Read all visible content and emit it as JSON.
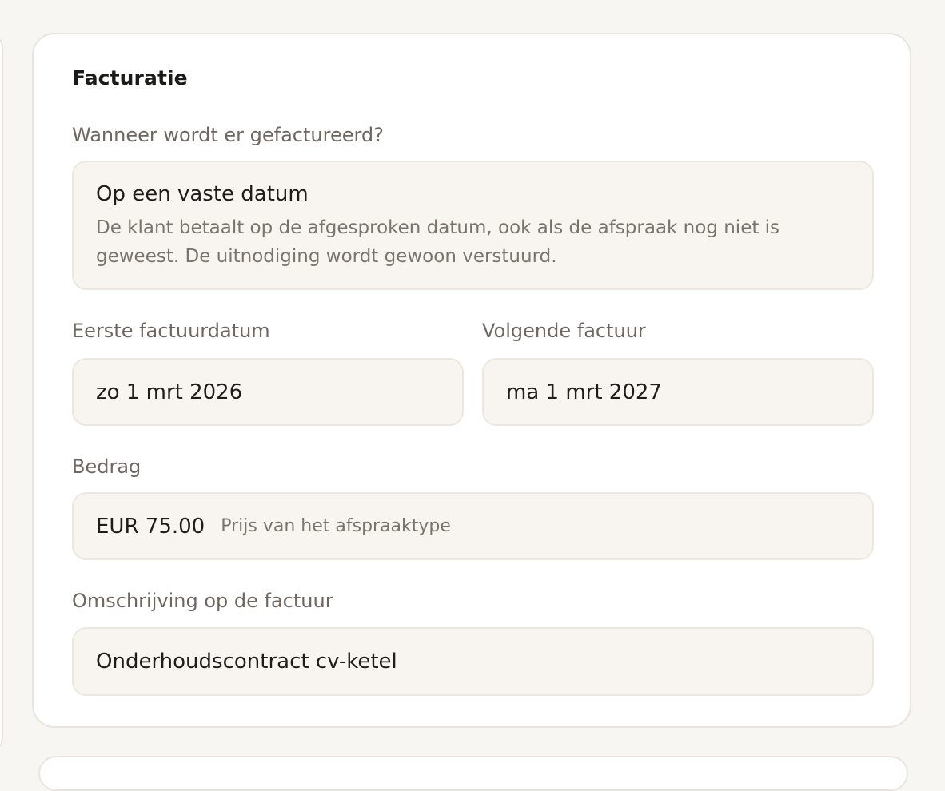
{
  "billing": {
    "title": "Facturatie",
    "when_label": "Wanneer wordt er gefactureerd?",
    "selected_option": {
      "title": "Op een vaste datum",
      "description": "De klant betaalt op de afgesproken datum, ook als de afspraak nog niet is geweest. De uitnodiging wordt gewoon verstuurd."
    },
    "first_invoice": {
      "label": "Eerste factuurdatum",
      "value": "zo 1 mrt 2026"
    },
    "next_invoice": {
      "label": "Volgende factuur",
      "value": "ma 1 mrt 2027"
    },
    "amount": {
      "label": "Bedrag",
      "value": "EUR 75.00",
      "hint": "Prijs van het afspraaktype"
    },
    "description": {
      "label": "Omschrijving op de factuur",
      "value": "Onderhoudscontract cv-ketel"
    }
  },
  "colors": {
    "page_background": "#f8f6f3",
    "card_background": "#ffffff",
    "field_background": "#f8f5f1",
    "border": "#e9e5de",
    "text_primary": "#1f1d1a",
    "text_secondary": "#6d6760"
  }
}
